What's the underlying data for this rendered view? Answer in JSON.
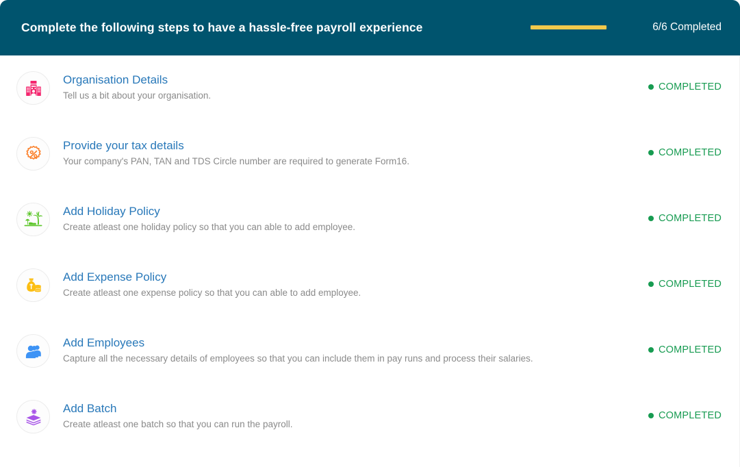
{
  "banner": {
    "title": "Complete the following steps to have a hassle-free payroll experience",
    "completed_label": "6/6 Completed",
    "progress_percent": 100,
    "background_color": "#00546e",
    "progress_color": "#f2c94c",
    "text_color": "#ffffff"
  },
  "status": {
    "completed_text": "COMPLETED",
    "completed_color": "#179b51"
  },
  "steps": [
    {
      "title": "Organisation Details",
      "description": "Tell us a bit about your organisation.",
      "status": "COMPLETED",
      "icon": "office-building-icon",
      "icon_color": "#f4266e"
    },
    {
      "title": "Provide your tax details",
      "description": "Your company's PAN, TAN and TDS Circle number are required to generate Form16.",
      "status": "COMPLETED",
      "icon": "percent-badge-icon",
      "icon_color": "#fb8330"
    },
    {
      "title": "Add Holiday Policy",
      "description": "Create atleast one holiday policy so that you can able to add employee.",
      "status": "COMPLETED",
      "icon": "palm-beach-icon",
      "icon_color": "#5cc62a"
    },
    {
      "title": "Add Expense Policy",
      "description": "Create atleast one expense policy so that you can able to add employee.",
      "status": "COMPLETED",
      "icon": "money-bag-coins-icon",
      "icon_color": "#fcbe12"
    },
    {
      "title": "Add Employees",
      "description": "Capture all the necessary details of employees so that you can include them in pay runs and process their salaries.",
      "status": "COMPLETED",
      "icon": "employees-group-icon",
      "icon_color": "#3d93f5"
    },
    {
      "title": "Add Batch",
      "description": "Create atleast one batch so that you can run the payroll.",
      "status": "COMPLETED",
      "icon": "layers-stack-icon",
      "icon_color": "#a855e8"
    }
  ]
}
